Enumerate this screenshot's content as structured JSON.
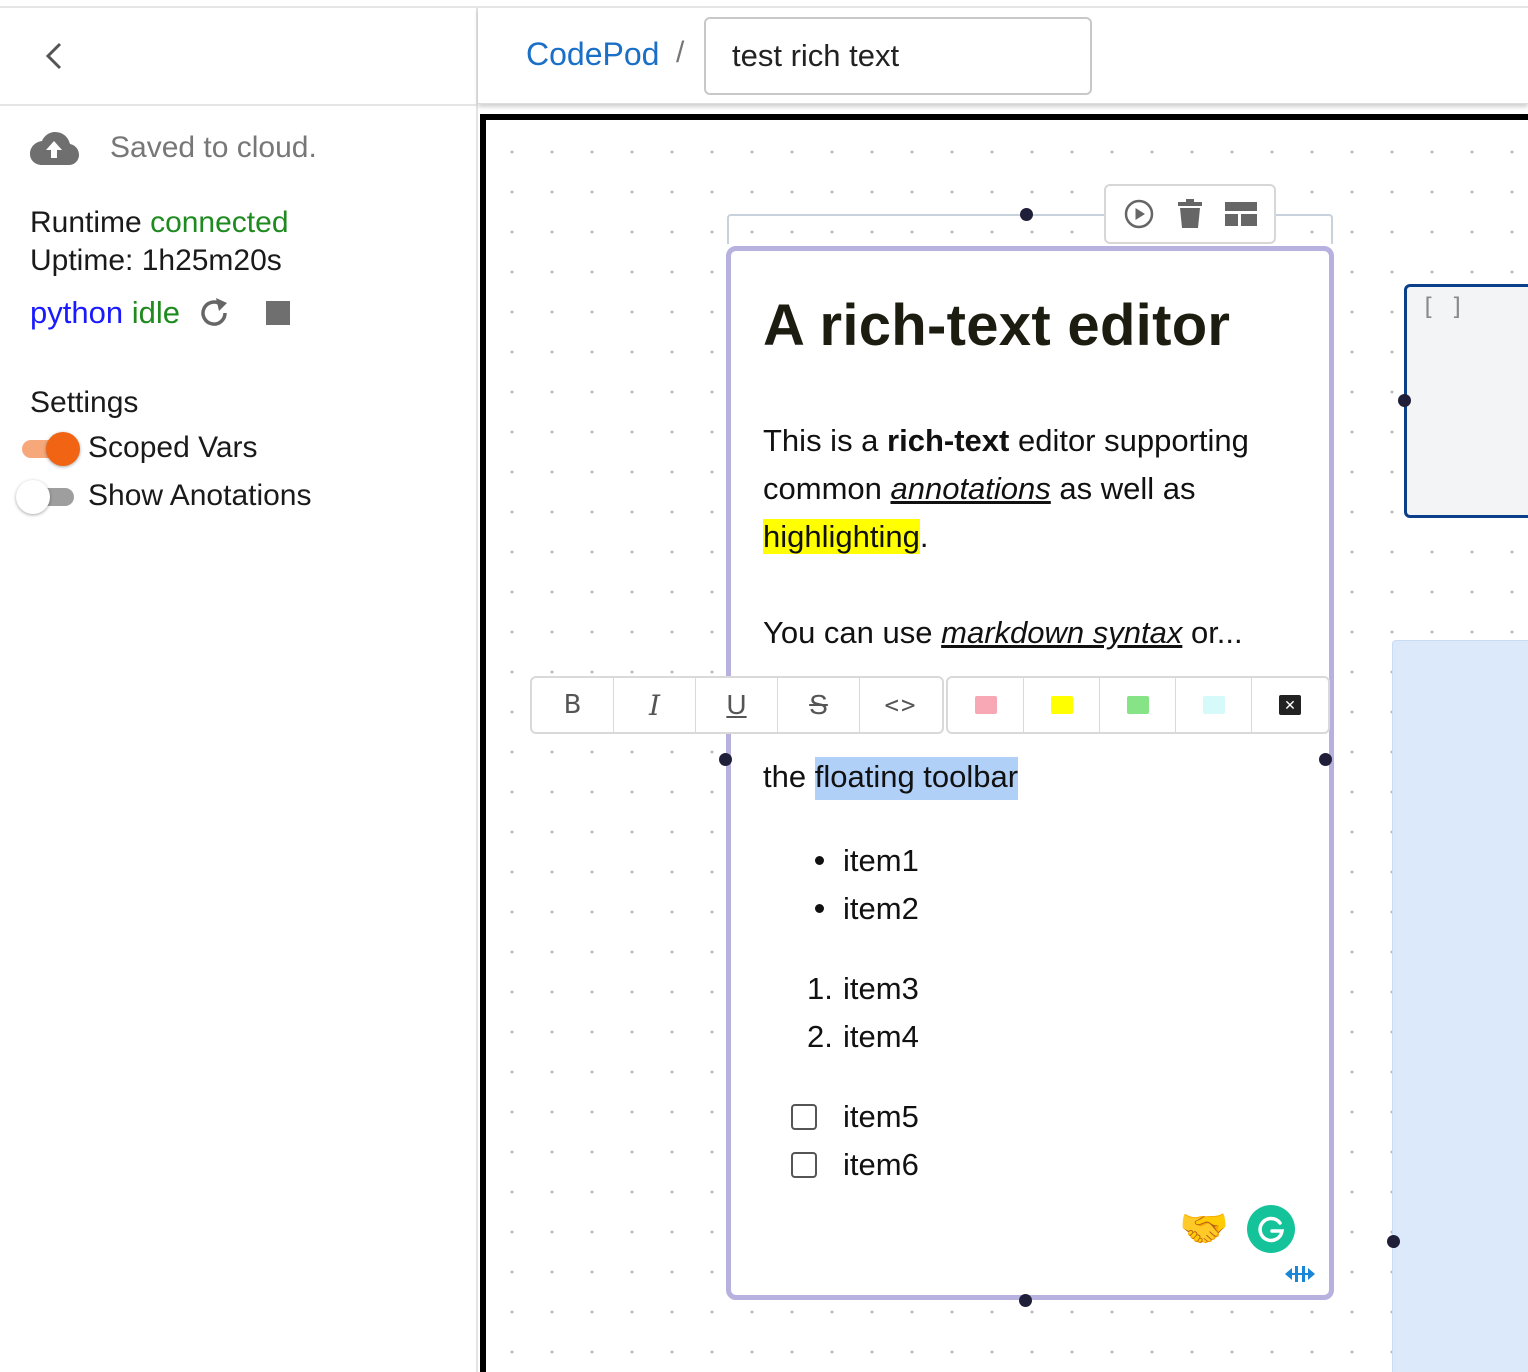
{
  "sidebar": {
    "save_status": "Saved to cloud.",
    "runtime_label": "Runtime",
    "runtime_status": "connected",
    "uptime": "Uptime: 1h25m20s",
    "kernel_name": "python",
    "kernel_status": "idle",
    "settings_title": "Settings",
    "toggles": [
      {
        "label": "Scoped Vars",
        "on": true
      },
      {
        "label": "Show Anotations",
        "on": false
      }
    ]
  },
  "header": {
    "breadcrumb_root": "CodePod",
    "separator": "/",
    "title_value": "test rich text"
  },
  "editor": {
    "heading": "A rich-text editor",
    "p1_pre": "This is a ",
    "p1_bold": "rich-text",
    "p1_mid": " editor supporting common ",
    "p1_annot": "annotations",
    "p1_post": " as well as ",
    "p1_highlight": "highlighting",
    "p1_end": ".",
    "p2_pre": "You can use ",
    "p2_link": "markdown syntax",
    "p2_post": " or...",
    "p3_pre": "the ",
    "p3_selected": "floating toolbar",
    "bullets": [
      "item1",
      "item2"
    ],
    "ordered": [
      {
        "num": "1.",
        "text": "item3"
      },
      {
        "num": "2.",
        "text": "item4"
      }
    ],
    "tasks": [
      "item5",
      "item6"
    ]
  },
  "floating_toolbar": {
    "format_buttons": [
      "B",
      "I",
      "U",
      "S",
      "<>"
    ],
    "highlight_colors": [
      "#f7a8b4",
      "#ffff00",
      "#86e486",
      "#d6fafa"
    ]
  },
  "code_pod": {
    "prompt": "[ ]"
  },
  "colors": {
    "accent_link": "#1a6fc6",
    "status_green": "#1f8a1f",
    "kernel_blue": "#1a1aff",
    "toggle_on": "#f06414",
    "pod_border": "#b7b1e0",
    "selection": "#b0d0f8"
  }
}
